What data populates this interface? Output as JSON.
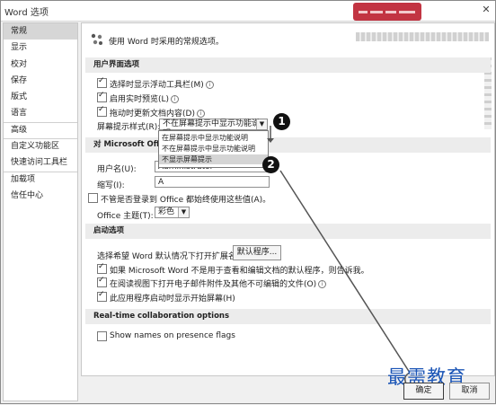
{
  "window": {
    "title": "Word 选项",
    "help": "?",
    "close": "✕"
  },
  "sidebar": {
    "items": [
      {
        "label": "常规"
      },
      {
        "label": "显示"
      },
      {
        "label": "校对"
      },
      {
        "label": "保存"
      },
      {
        "label": "版式"
      },
      {
        "label": "语言"
      },
      {
        "label": "高级"
      },
      {
        "label": "自定义功能区"
      },
      {
        "label": "快速访问工具栏"
      },
      {
        "label": "加载项"
      },
      {
        "label": "信任中心"
      }
    ]
  },
  "general": {
    "heading": "使用 Word 时采用的常规选项。",
    "ui_section": "用户界面选项",
    "options": [
      {
        "label": "选择时显示浮动工具栏(M)",
        "checked": true
      },
      {
        "label": "启用实时预览(L)",
        "checked": true
      },
      {
        "label": "拖动时更新文档内容(D)",
        "checked": true
      }
    ],
    "screentip_label": "屏幕提示样式(R):",
    "screentip_value": "不在屏幕提示中显示功能说明",
    "dropdown_options": [
      "在屏幕提示中显示功能说明",
      "不在屏幕提示中显示功能说明",
      "不显示屏幕提示"
    ],
    "personalize_section": "对 Microsoft Office",
    "username_label": "用户名(U):",
    "username_value": "Administrator",
    "initials_label": "缩写(I):",
    "initials_value": "A",
    "always_use_label": "不管是否登录到 Office 都始终使用这些值(A)。",
    "theme_label": "Office 主题(T):",
    "theme_value": "彩色",
    "startup_section": "启动选项",
    "default_ext_label": "选择希望 Word 默认情况下打开扩展名:",
    "default_programs_button": "默认程序...",
    "startup_options": [
      {
        "label": "如果 Microsoft Word 不是用于查看和编辑文档的默认程序，则告诉我。",
        "checked": true
      },
      {
        "label": "在阅读视图下打开电子邮件附件及其他不可编辑的文件(O)",
        "checked": true
      },
      {
        "label": "此应用程序启动时显示开始屏幕(H)",
        "checked": true
      }
    ],
    "realtime_section": "Real-time collaboration options",
    "presence_label": "Show names on presence flags",
    "presence_checked": false
  },
  "callouts": [
    "1",
    "2"
  ],
  "footer": {
    "ok": "确定",
    "cancel": "取消"
  },
  "watermark": "最需教育",
  "colors": {
    "callout_line": "#555555",
    "watermark_text": "#1b55b6",
    "watermark_badge": "#c23442"
  }
}
